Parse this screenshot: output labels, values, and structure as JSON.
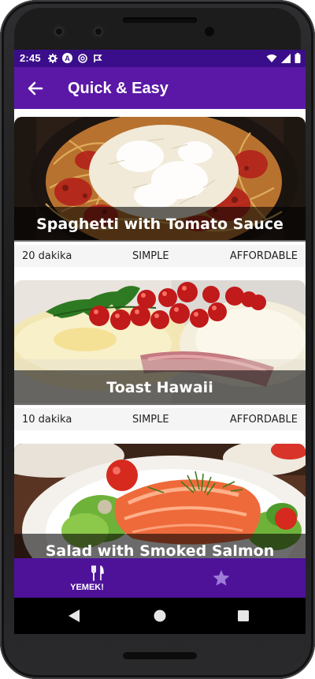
{
  "status_bar": {
    "time": "2:45",
    "icons_left": [
      "settings-icon",
      "a-icon",
      "at-icon",
      "flag-icon"
    ],
    "icons_right": [
      "wifi-icon",
      "signal-icon",
      "battery-icon"
    ]
  },
  "app_bar": {
    "title": "Quick & Easy",
    "back_icon": "arrow-left-icon"
  },
  "meals": [
    {
      "title": "Spaghetti with Tomato Sauce",
      "duration": "20 dakika",
      "complexity": "SIMPLE",
      "affordability": "AFFORDABLE"
    },
    {
      "title": "Toast Hawaii",
      "duration": "10 dakika",
      "complexity": "SIMPLE",
      "affordability": "AFFORDABLE"
    },
    {
      "title": "Salad with Smoked Salmon",
      "duration": "",
      "complexity": "",
      "affordability": ""
    }
  ],
  "bottom_nav": {
    "items": [
      {
        "label": "YEMEK!",
        "icon": "restaurant-icon",
        "active": true
      },
      {
        "label": "",
        "icon": "star-icon",
        "active": false
      }
    ]
  },
  "colors": {
    "status_bar": "#3a0e8a",
    "app_bar": "#5b18a6",
    "bottom_nav": "#4e1299",
    "inactive_star": "#9c7cd8"
  }
}
